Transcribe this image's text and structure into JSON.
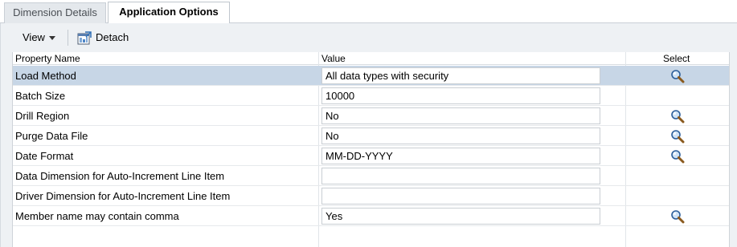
{
  "tabs": [
    {
      "label": "Dimension Details",
      "active": false
    },
    {
      "label": "Application Options",
      "active": true
    }
  ],
  "toolbar": {
    "view_label": "View",
    "detach_label": "Detach"
  },
  "table": {
    "headers": {
      "property": "Property Name",
      "value": "Value",
      "select": "Select"
    },
    "rows": [
      {
        "property": "Load Method",
        "value": "All data types with security",
        "has_select": true,
        "selected": true
      },
      {
        "property": "Batch Size",
        "value": "10000",
        "has_select": false,
        "selected": false
      },
      {
        "property": "Drill Region",
        "value": "No",
        "has_select": true,
        "selected": false
      },
      {
        "property": "Purge Data File",
        "value": "No",
        "has_select": true,
        "selected": false
      },
      {
        "property": "Date Format",
        "value": "MM-DD-YYYY",
        "has_select": true,
        "selected": false
      },
      {
        "property": "Data Dimension for Auto-Increment Line Item",
        "value": "",
        "has_select": false,
        "selected": false
      },
      {
        "property": "Driver Dimension for Auto-Increment Line Item",
        "value": "",
        "has_select": false,
        "selected": false
      },
      {
        "property": "Member name may contain comma",
        "value": "Yes",
        "has_select": true,
        "selected": false
      }
    ]
  },
  "icons": {
    "select": "magnifier-icon",
    "detach": "detach-icon",
    "view_menu": "caret-down-icon"
  },
  "colors": {
    "selected_row": "#c7d6e6",
    "panel_bg": "#eef1f4",
    "inactive_tab": "#e4e8ec"
  }
}
